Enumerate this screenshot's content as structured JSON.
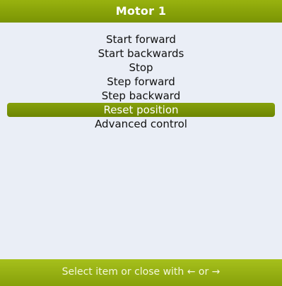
{
  "window": {
    "title": "Motor 1"
  },
  "menu": {
    "items": [
      {
        "label": "Start forward"
      },
      {
        "label": "Start backwards"
      },
      {
        "label": "Stop"
      },
      {
        "label": "Step forward"
      },
      {
        "label": "Step backward"
      },
      {
        "label": "Reset position"
      },
      {
        "label": "Advanced control"
      }
    ],
    "selected_label": "Reset position"
  },
  "footer": {
    "hint": "Select item or close with ← or →"
  },
  "colors": {
    "header": "#7a9404",
    "selection": "#7a9404",
    "footer": "#98b214",
    "background": "#eaeef6"
  }
}
